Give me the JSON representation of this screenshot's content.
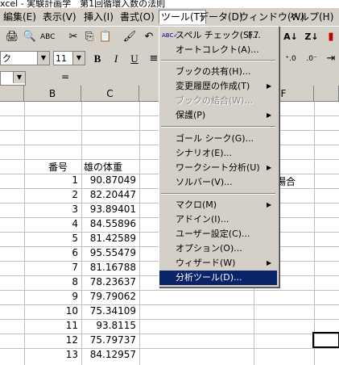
{
  "window": {
    "title": "xcel - 実験計画学__第1回循環入数の法則"
  },
  "menubar": {
    "items": [
      {
        "label": "編集(E)"
      },
      {
        "label": "表示(V)"
      },
      {
        "label": "挿入(I)"
      },
      {
        "label": "書式(O)"
      },
      {
        "label": "ツール(T)"
      },
      {
        "label": "データ(D)"
      },
      {
        "label": "ウィンドウ(W)"
      },
      {
        "label": "ヘルプ(H)"
      }
    ]
  },
  "toolbar": {
    "font_name": "ク",
    "font_size": "11",
    "bold": "B",
    "italic": "I",
    "underline": "U"
  },
  "formula_bar": {
    "equals": "="
  },
  "columns": [
    "B",
    "C",
    "F"
  ],
  "sheet": {
    "header_b": "番号",
    "header_c": "雄の体重",
    "side_text": "場合",
    "rows": [
      {
        "num": "1",
        "weight": "90.87049"
      },
      {
        "num": "2",
        "weight": "82.20447"
      },
      {
        "num": "3",
        "weight": "93.89401"
      },
      {
        "num": "4",
        "weight": "84.55896"
      },
      {
        "num": "5",
        "weight": "81.42589"
      },
      {
        "num": "6",
        "weight": "95.55479"
      },
      {
        "num": "7",
        "weight": "81.16788"
      },
      {
        "num": "8",
        "weight": "78.23637"
      },
      {
        "num": "9",
        "weight": "79.79062"
      },
      {
        "num": "10",
        "weight": "75.34109"
      },
      {
        "num": "11",
        "weight": "93.8115"
      },
      {
        "num": "12",
        "weight": "75.79737"
      },
      {
        "num": "13",
        "weight": "84.12957"
      }
    ]
  },
  "tools_menu": {
    "spell_check": "スペル チェック(S)...",
    "spell_shortcut": "F7",
    "autocorrect": "オートコレクト(A)...",
    "share_workbook": "ブックの共有(H)...",
    "track_changes": "変更履歴の作成(T)",
    "merge_workbooks": "ブックの結合(W)...",
    "protection": "保護(P)",
    "goal_seek": "ゴール シーク(G)...",
    "scenarios": "シナリオ(E)...",
    "auditing": "ワークシート分析(U)",
    "solver": "ソルバー(V)...",
    "macro": "マクロ(M)",
    "addins": "アドイン(I)...",
    "customize": "ユーザー設定(C)...",
    "options": "オプション(O)...",
    "wizard": "ウィザード(W)",
    "data_analysis": "分析ツール(D)..."
  }
}
